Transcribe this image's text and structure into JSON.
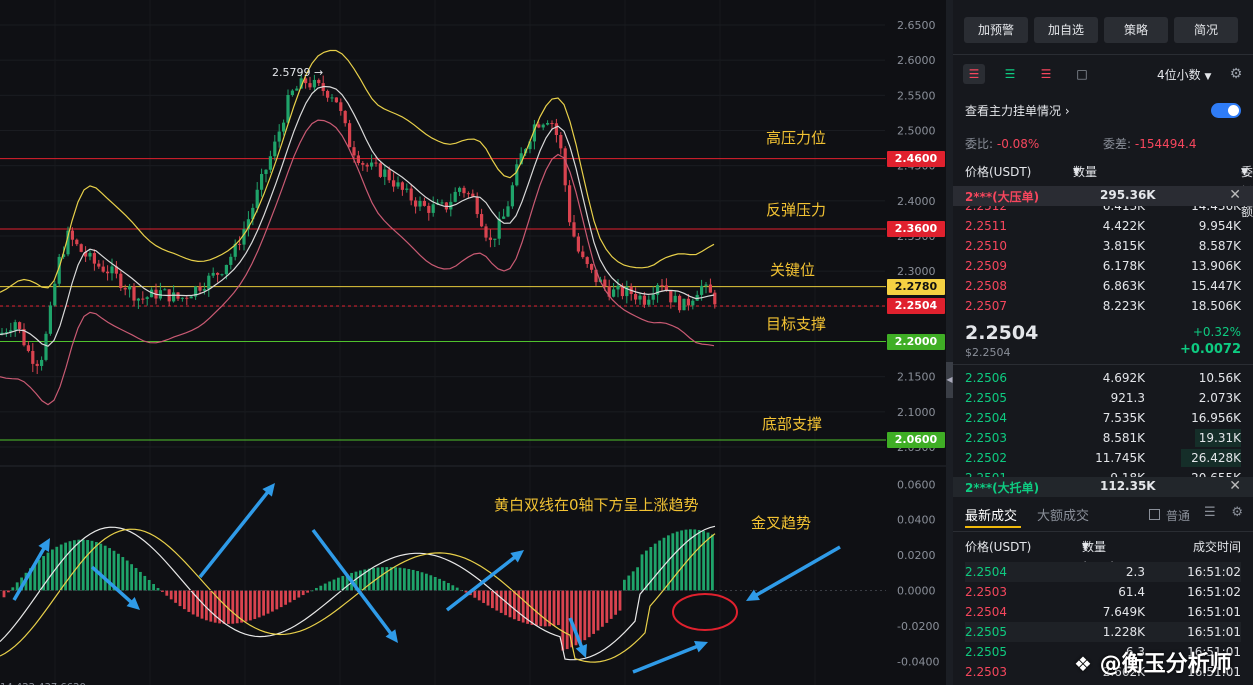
{
  "chart": {
    "y_ticks": [
      "2.6500",
      "2.6000",
      "2.5500",
      "2.5000",
      "2.4500",
      "2.4000",
      "2.3500",
      "2.3000",
      "2.2500",
      "2.2000",
      "2.1500",
      "2.1000",
      "2.0500"
    ],
    "macd_ticks": [
      "0.0600",
      "0.0400",
      "0.0200",
      "0.0000",
      "-0.0200",
      "-0.0400"
    ],
    "peak_label": "2.5799",
    "bottom_label": "14,422,437.6620",
    "levels": [
      {
        "price": "2.4600",
        "name": "高压力位",
        "color": "#e0212e",
        "tag_bg": "#e0212e",
        "tag_fg": "#ffffff"
      },
      {
        "price": "2.3600",
        "name": "反弹压力",
        "color": "#e0212e",
        "tag_bg": "#e0212e",
        "tag_fg": "#ffffff"
      },
      {
        "price": "2.2780",
        "name": "关键位",
        "color": "#e6c93b",
        "tag_bg": "#f5d142",
        "tag_fg": "#111111"
      },
      {
        "price": "2.2504",
        "name": "目标支撑",
        "color": "#e0212e",
        "tag_bg": "#e0212e",
        "tag_fg": "#ffffff"
      },
      {
        "price": "2.2000",
        "name": "",
        "color": "#4fc22d",
        "tag_bg": "#3fae25",
        "tag_fg": "#ffffff"
      },
      {
        "price": "2.0600",
        "name": "底部支撑",
        "color": "#4fc22d",
        "tag_bg": "#3fae25",
        "tag_fg": "#ffffff"
      }
    ],
    "macd_note": "黄白双线在0轴下方呈上涨趋势",
    "golden_cross": "金叉趋势"
  },
  "panel": {
    "buttons": [
      "加预警",
      "加自选",
      "策略",
      "简况"
    ],
    "decimals": "4位小数",
    "depth_link": "查看主力挂单情况",
    "ratio_label": "委比:",
    "ratio_value": "-0.08%",
    "diff_label": "委差:",
    "diff_value": "-154494.4",
    "headers": {
      "price": "价格(USDT)",
      "qty": "数量(XRP)",
      "amount": "委托额"
    },
    "ask_banner": {
      "price": "2***(大压单)",
      "qty": "295.36K"
    },
    "asks": [
      {
        "price": "2.2512",
        "qty": "6.413K",
        "amount": "14.436K"
      },
      {
        "price": "2.2511",
        "qty": "4.422K",
        "amount": "9.954K"
      },
      {
        "price": "2.2510",
        "qty": "3.815K",
        "amount": "8.587K"
      },
      {
        "price": "2.2509",
        "qty": "6.178K",
        "amount": "13.906K"
      },
      {
        "price": "2.2508",
        "qty": "6.863K",
        "amount": "15.447K"
      },
      {
        "price": "2.2507",
        "qty": "8.223K",
        "amount": "18.506K"
      }
    ],
    "last_price": "2.2504",
    "last_price_usd": "$2.2504",
    "change_pct": "+0.32%",
    "change_abs": "+0.0072",
    "bids": [
      {
        "price": "2.2506",
        "qty": "4.692K",
        "amount": "10.56K"
      },
      {
        "price": "2.2505",
        "qty": "921.3",
        "amount": "2.073K"
      },
      {
        "price": "2.2504",
        "qty": "7.535K",
        "amount": "16.956K"
      },
      {
        "price": "2.2503",
        "qty": "8.581K",
        "amount": "19.31K"
      },
      {
        "price": "2.2502",
        "qty": "11.745K",
        "amount": "26.428K"
      },
      {
        "price": "2.2501",
        "qty": "9.18K",
        "amount": "20.655K"
      }
    ],
    "bid_banner": {
      "price": "2***(大托单)",
      "qty": "112.35K"
    },
    "trade_tabs": [
      "最新成交",
      "大额成交"
    ],
    "normal_label": "普通",
    "trade_headers": {
      "price": "价格(USDT)",
      "qty": "数量(XRP)",
      "time": "成交时间"
    },
    "trades": [
      {
        "price": "2.2504",
        "qty": "2.3",
        "time": "16:51:02",
        "side": "buy"
      },
      {
        "price": "2.2503",
        "qty": "61.4",
        "time": "16:51:02",
        "side": "sell"
      },
      {
        "price": "2.2504",
        "qty": "7.649K",
        "time": "16:51:01",
        "side": "sell"
      },
      {
        "price": "2.2505",
        "qty": "1.228K",
        "time": "16:51:01",
        "side": "buy"
      },
      {
        "price": "2.2505",
        "qty": "6.3",
        "time": "16:51:01",
        "side": "buy"
      },
      {
        "price": "2.2503",
        "qty": "2.662K",
        "time": "16:51:01",
        "side": "sell"
      }
    ]
  },
  "watermark": "@衡玉分析师"
}
